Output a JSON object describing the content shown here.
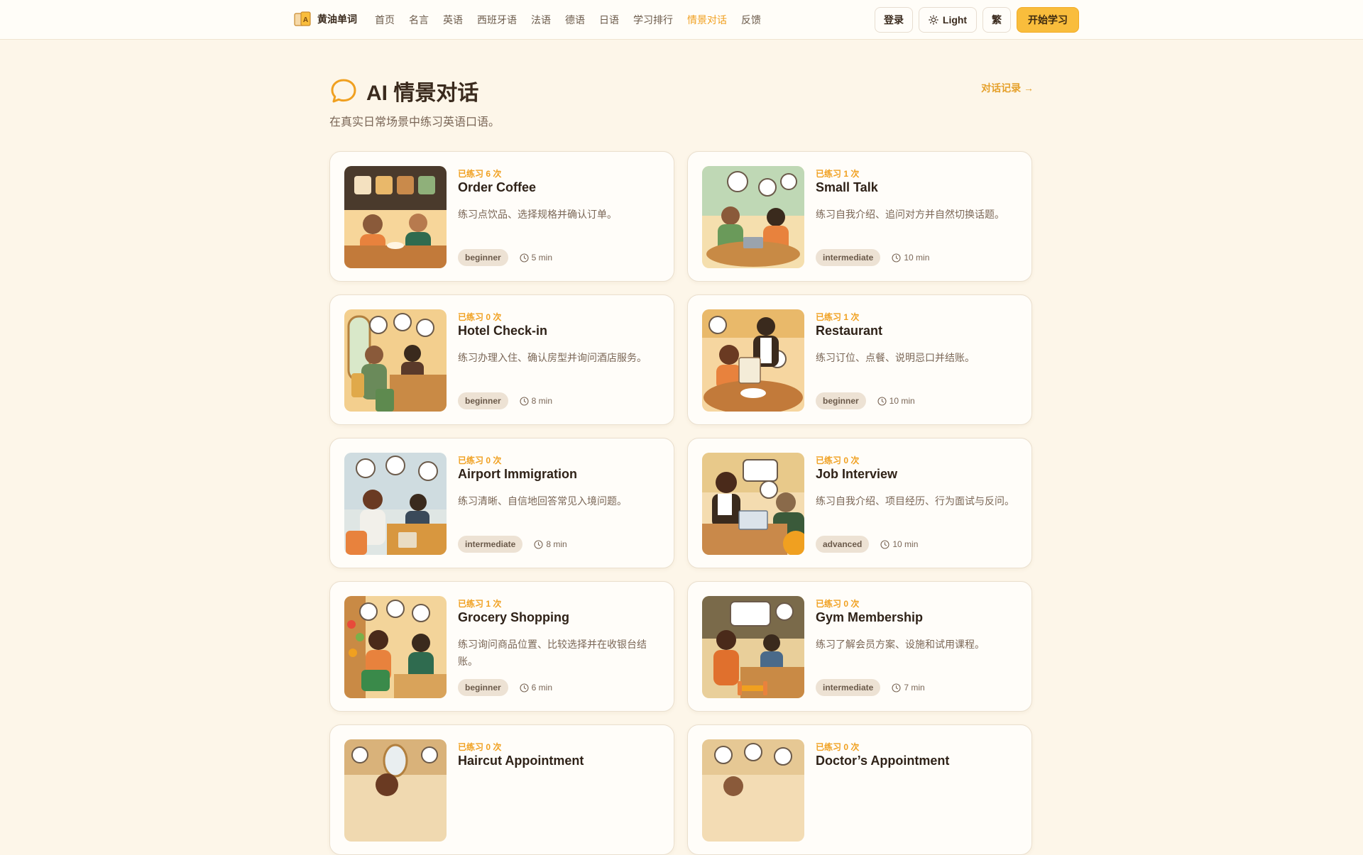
{
  "header": {
    "brand": "黄油单词",
    "nav": [
      {
        "label": "首页",
        "active": false
      },
      {
        "label": "名言",
        "active": false
      },
      {
        "label": "英语",
        "active": false
      },
      {
        "label": "西班牙语",
        "active": false
      },
      {
        "label": "法语",
        "active": false
      },
      {
        "label": "德语",
        "active": false
      },
      {
        "label": "日语",
        "active": false
      },
      {
        "label": "学习排行",
        "active": false
      },
      {
        "label": "情景对话",
        "active": true
      },
      {
        "label": "反馈",
        "active": false
      }
    ],
    "login": "登录",
    "theme": "Light",
    "traditional": "繁",
    "start": "开始学习"
  },
  "page": {
    "title": "AI 情景对话",
    "subtitle": "在真实日常场景中练习英语口语。",
    "history": "对话记录 →"
  },
  "scenarios": [
    {
      "practiced": "已练习 6 次",
      "title": "Order Coffee",
      "desc": "练习点饮品、选择规格并确认订单。",
      "level": "beginner",
      "duration": "5 min",
      "icon": "coffee-scene"
    },
    {
      "practiced": "已练习 1 次",
      "title": "Small Talk",
      "desc": "练习自我介绍、追问对方并自然切换话题。",
      "level": "intermediate",
      "duration": "10 min",
      "icon": "chat-scene"
    },
    {
      "practiced": "已练习 0 次",
      "title": "Hotel Check-in",
      "desc": "练习办理入住、确认房型并询问酒店服务。",
      "level": "beginner",
      "duration": "8 min",
      "icon": "hotel-scene"
    },
    {
      "practiced": "已练习 1 次",
      "title": "Restaurant",
      "desc": "练习订位、点餐、说明忌口并结账。",
      "level": "beginner",
      "duration": "10 min",
      "icon": "restaurant-scene"
    },
    {
      "practiced": "已练习 0 次",
      "title": "Airport Immigration",
      "desc": "练习清晰、自信地回答常见入境问题。",
      "level": "intermediate",
      "duration": "8 min",
      "icon": "airport-scene"
    },
    {
      "practiced": "已练习 0 次",
      "title": "Job Interview",
      "desc": "练习自我介绍、项目经历、行为面试与反问。",
      "level": "advanced",
      "duration": "10 min",
      "icon": "interview-scene"
    },
    {
      "practiced": "已练习 1 次",
      "title": "Grocery Shopping",
      "desc": "练习询问商品位置、比较选择并在收银台结账。",
      "level": "beginner",
      "duration": "6 min",
      "icon": "grocery-scene"
    },
    {
      "practiced": "已练习 0 次",
      "title": "Gym Membership",
      "desc": "练习了解会员方案、设施和试用课程。",
      "level": "intermediate",
      "duration": "7 min",
      "icon": "gym-scene"
    },
    {
      "practiced": "已练习 0 次",
      "title": "Haircut Appointment",
      "desc": "",
      "level": "",
      "duration": "",
      "icon": "haircut-scene"
    },
    {
      "practiced": "已练习 0 次",
      "title": "Doctor’s Appointment",
      "desc": "",
      "level": "",
      "duration": "",
      "icon": "doctor-scene"
    }
  ],
  "colors": {
    "accent": "#f0a020",
    "primary_button": "#f9bd3c",
    "background": "#fdf6e9",
    "card": "#fffdf9"
  }
}
